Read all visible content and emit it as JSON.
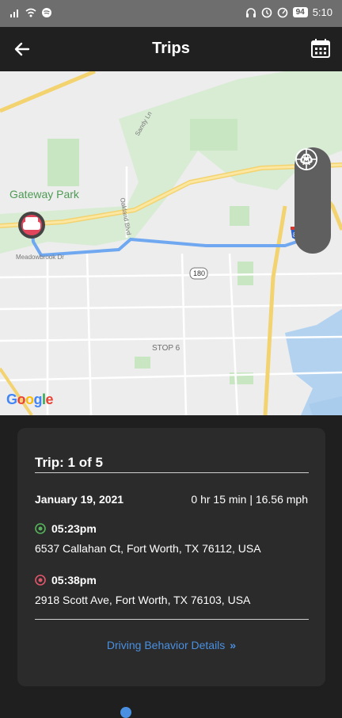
{
  "status_bar": {
    "time": "5:10",
    "battery": "94"
  },
  "header": {
    "title": "Trips"
  },
  "map": {
    "park_label": "Gateway Park",
    "stop_label": "STOP 6",
    "highway_label": "180",
    "interstate_label": "820",
    "street_meadowbrook": "Meadowbrook Dr",
    "street_sandy": "Sandy Ln",
    "street_oakland": "Oakland Blvd",
    "google": [
      "G",
      "o",
      "o",
      "g",
      "l",
      "e"
    ],
    "route_color": "#6fa8f0"
  },
  "trip": {
    "title": "Trip: 1 of 5",
    "date": "January 19, 2021",
    "summary": "0 hr 15 min  | 16.56 mph",
    "start": {
      "time": "05:23pm",
      "address": "6537 Callahan Ct, Fort Worth, TX 76112, USA"
    },
    "end": {
      "time": "05:38pm",
      "address": "2918 Scott Ave, Fort Worth, TX 76103, USA"
    },
    "details_label": "Driving Behavior Details"
  },
  "colors": {
    "accent": "#4a90e2",
    "start": "#56b35b",
    "end": "#e0566a"
  }
}
